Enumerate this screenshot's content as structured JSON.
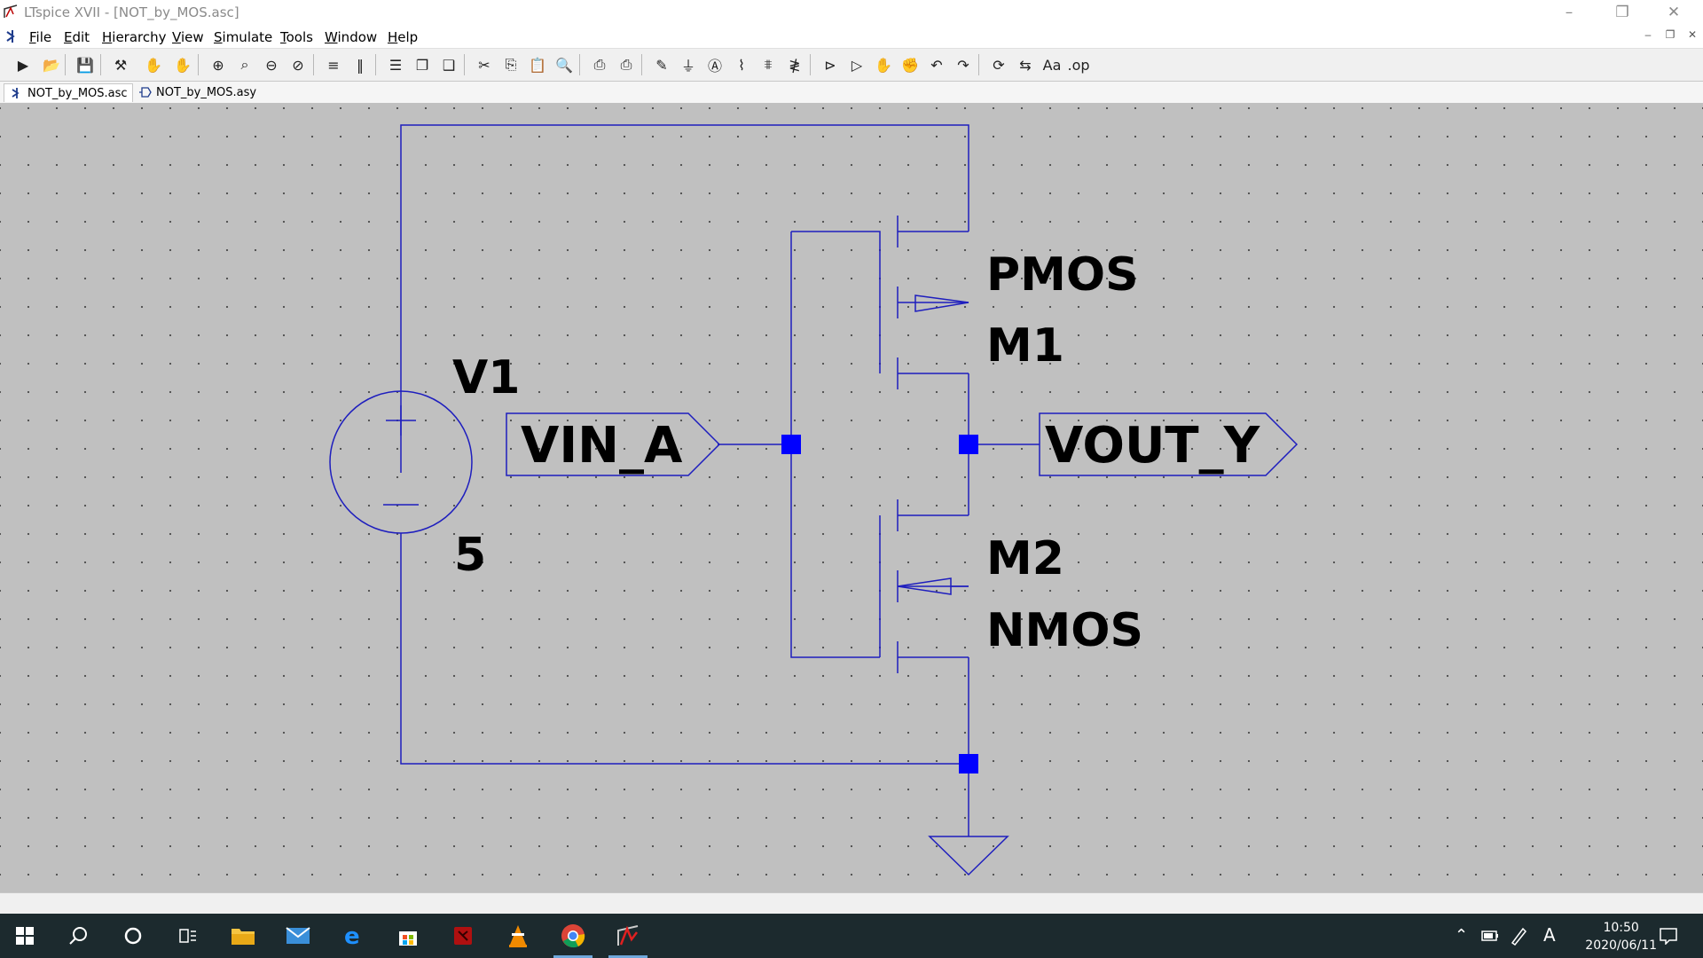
{
  "window": {
    "title": "LTspice XVII - [NOT_by_MOS.asc]"
  },
  "menu": [
    {
      "label": "File",
      "u": "F",
      "rest": "ile"
    },
    {
      "label": "Edit",
      "u": "E",
      "rest": "dit"
    },
    {
      "label": "Hierarchy",
      "u": "H",
      "rest": "ierarchy"
    },
    {
      "label": "View",
      "u": "V",
      "rest": "iew"
    },
    {
      "label": "Simulate",
      "u": "S",
      "rest": "imulate"
    },
    {
      "label": "Tools",
      "u": "T",
      "rest": "ools"
    },
    {
      "label": "Window",
      "u": "W",
      "rest": "indow"
    },
    {
      "label": "Help",
      "u": "H",
      "rest": "elp"
    }
  ],
  "toolbar_icons": [
    "run-icon",
    "open-icon",
    "save-icon",
    "control-panel-icon",
    "halt-icon",
    "pan-icon",
    "zoom-in-icon",
    "zoom-area-icon",
    "zoom-out-icon",
    "zoom-fit-icon",
    "tile-horizontal-icon",
    "tile-vertical-icon",
    "schematic-icon",
    "window-stack-icon",
    "cascade-icon",
    "cut-icon",
    "copy-icon",
    "paste-icon",
    "find-icon",
    "print-icon",
    "print-setup-icon",
    "wire-icon",
    "ground-icon",
    "label-net-icon",
    "resistor-icon",
    "capacitor-icon",
    "inductor-icon",
    "diode-icon",
    "component-icon",
    "move-icon",
    "drag-icon",
    "undo-icon",
    "redo-icon",
    "rotate-icon",
    "mirror-icon",
    "text-icon",
    "spice-directive-icon"
  ],
  "tabs": [
    {
      "label": "NOT_by_MOS.asc",
      "active": true
    },
    {
      "label": "NOT_by_MOS.asy",
      "active": false
    }
  ],
  "schematic": {
    "source_name": "V1",
    "source_value": "5",
    "input_net": "VIN_A",
    "output_net": "VOUT_Y",
    "pmos_model": "PMOS",
    "pmos_name": "M1",
    "nmos_name": "M2",
    "nmos_model": "NMOS",
    "wire_color": "#1e1ebe",
    "junction_color": "#0000ff"
  },
  "taskbar": {
    "time": "10:50",
    "date": "2020/06/11",
    "ime": "A"
  }
}
